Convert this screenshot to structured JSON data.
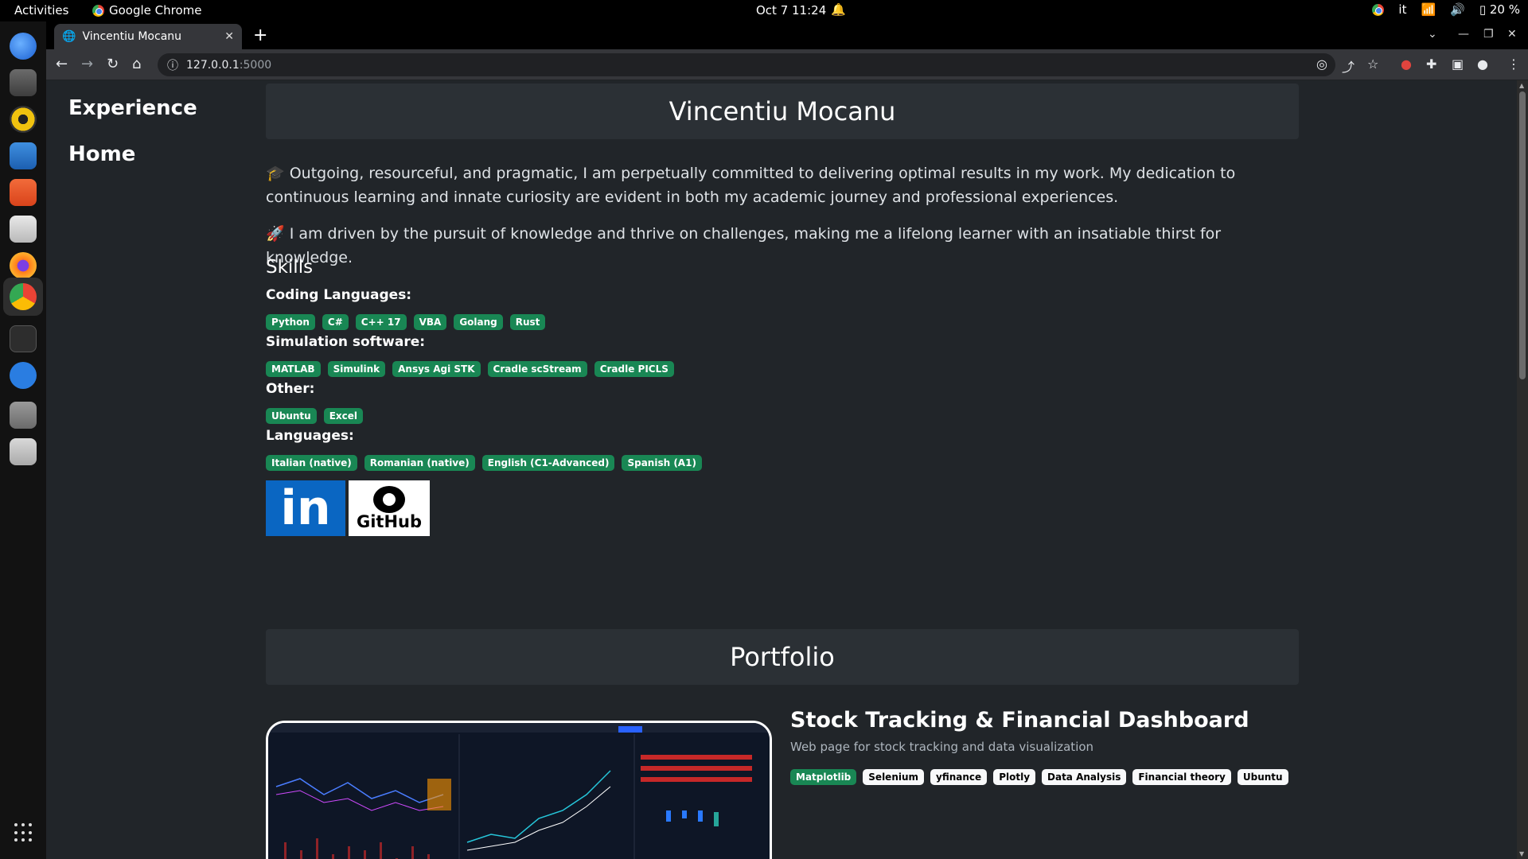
{
  "os": {
    "activities": "Activities",
    "app_name": "Google Chrome",
    "clock": "Oct 7  11:24",
    "keyboard_layout": "it",
    "battery": "20 %"
  },
  "browser": {
    "tab_title": "Vincentiu Mocanu",
    "url": "127.0.0.1",
    "url_port": ":5000"
  },
  "sidebar": {
    "items": [
      {
        "label": "Experience"
      },
      {
        "label": "Home"
      }
    ]
  },
  "header": {
    "name": "Vincentiu Mocanu"
  },
  "about": {
    "paragraph1": "🎓 Outgoing, resourceful, and pragmatic, I am perpetually committed to delivering optimal results in my work. My dedication to continuous learning and innate curiosity are evident in both my academic journey and professional experiences.",
    "paragraph2": "🚀 I am driven by the pursuit of knowledge and thrive on challenges, making me a lifelong learner with an insatiable thirst for knowledge."
  },
  "skills": {
    "title": "Skills",
    "groups": [
      {
        "label": "Coding Languages:",
        "items": [
          "Python",
          "C#",
          "C++ 17",
          "VBA",
          "Golang",
          "Rust"
        ]
      },
      {
        "label": "Simulation software:",
        "items": [
          "MATLAB",
          "Simulink",
          "Ansys Agi STK",
          "Cradle scStream",
          "Cradle PICLS"
        ]
      },
      {
        "label": "Other:",
        "items": [
          "Ubuntu",
          "Excel"
        ]
      },
      {
        "label": "Languages:",
        "items": [
          "Italian (native)",
          "Romanian (native)",
          "English (C1-Advanced)",
          "Spanish (A1)"
        ]
      }
    ]
  },
  "social": {
    "linkedin_text": "in",
    "github_text": "GitHub"
  },
  "portfolio": {
    "title": "Portfolio",
    "project": {
      "title": "Stock Tracking & Financial Dashboard",
      "description": "Web page for stock tracking and data visualization",
      "tags": [
        "Matplotlib",
        "Selenium",
        "yfinance",
        "Plotly",
        "Data Analysis",
        "Financial theory",
        "Ubuntu"
      ]
    }
  }
}
